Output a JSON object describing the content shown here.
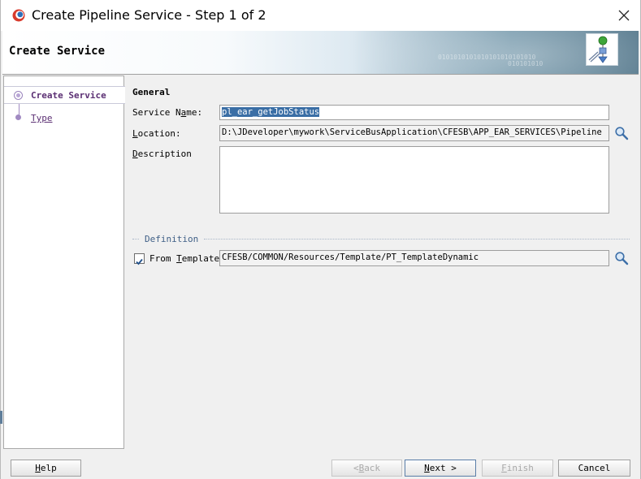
{
  "window": {
    "title": "Create Pipeline Service - Step 1 of 2"
  },
  "banner": {
    "title": "Create Service",
    "binary_text": "0101010101010101010101010",
    "binary_text2": "010101010"
  },
  "nav": {
    "items": [
      {
        "label": "Create Service",
        "selected": true
      },
      {
        "label": "Type",
        "selected": false
      }
    ]
  },
  "form": {
    "section_general": "General",
    "service_name": {
      "label_pre": "Service N",
      "label_mn": "a",
      "label_post": "me:",
      "value": "pl_ear_getJobStatus"
    },
    "location": {
      "label_mn": "L",
      "label_post": "ocation:",
      "value": "D:\\JDeveloper\\mywork\\ServiceBusApplication\\CFESB\\APP_EAR_SERVICES\\Pipeline"
    },
    "description": {
      "label_mn": "D",
      "label_post": "escription",
      "value": ""
    },
    "section_definition": "Definition",
    "from_template": {
      "label_pre": "From ",
      "label_mn": "T",
      "label_post": "emplate",
      "checked": true,
      "value": "CFESB/COMMON/Resources/Template/PT_TemplateDynamic"
    }
  },
  "buttons": {
    "help": {
      "mn": "H",
      "rest": "elp"
    },
    "back": {
      "pre": "< ",
      "mn": "B",
      "rest": "ack"
    },
    "next": {
      "mn": "N",
      "rest": "ext >"
    },
    "finish": {
      "mn": "F",
      "rest": "inish"
    },
    "cancel": {
      "label": "Cancel"
    }
  },
  "icons": {
    "app": "oracle-jdev-icon",
    "close": "close-icon",
    "search": "magnifier-icon",
    "banner": "pipeline-service-icon"
  },
  "colors": {
    "selection": "#3a6ea5",
    "nav_text": "#5b2f73",
    "definition_label": "#3f5f86"
  }
}
